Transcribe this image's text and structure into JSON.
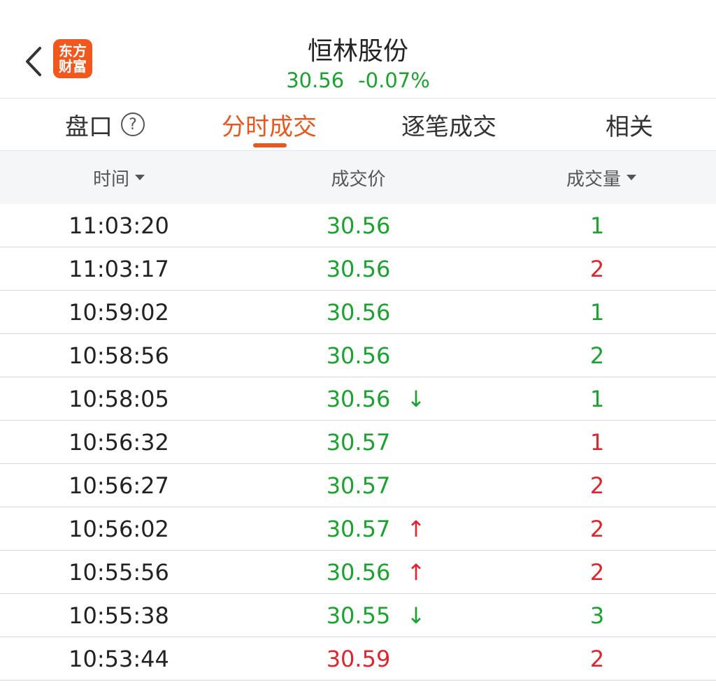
{
  "header": {
    "logo_line1": "东方",
    "logo_line2": "财富",
    "title": "恒林股份",
    "price": "30.56",
    "change": "-0.07%"
  },
  "tabs": [
    {
      "label": "盘口",
      "help": "?"
    },
    {
      "label": "分时成交"
    },
    {
      "label": "逐笔成交"
    },
    {
      "label": "相关"
    }
  ],
  "columns": {
    "time": "时间",
    "price": "成交价",
    "volume": "成交量"
  },
  "colors": {
    "green": "#1aa32e",
    "red": "#e0252f",
    "accent": "#e8581e"
  },
  "trades": [
    {
      "time": "11:03:20",
      "price": "30.56",
      "price_color": "green",
      "arrow": "",
      "arrow_color": "",
      "volume": "1",
      "volume_color": "green"
    },
    {
      "time": "11:03:17",
      "price": "30.56",
      "price_color": "green",
      "arrow": "",
      "arrow_color": "",
      "volume": "2",
      "volume_color": "red"
    },
    {
      "time": "10:59:02",
      "price": "30.56",
      "price_color": "green",
      "arrow": "",
      "arrow_color": "",
      "volume": "1",
      "volume_color": "green"
    },
    {
      "time": "10:58:56",
      "price": "30.56",
      "price_color": "green",
      "arrow": "",
      "arrow_color": "",
      "volume": "2",
      "volume_color": "green"
    },
    {
      "time": "10:58:05",
      "price": "30.56",
      "price_color": "green",
      "arrow": "↓",
      "arrow_color": "green",
      "volume": "1",
      "volume_color": "green"
    },
    {
      "time": "10:56:32",
      "price": "30.57",
      "price_color": "green",
      "arrow": "",
      "arrow_color": "",
      "volume": "1",
      "volume_color": "red"
    },
    {
      "time": "10:56:27",
      "price": "30.57",
      "price_color": "green",
      "arrow": "",
      "arrow_color": "",
      "volume": "2",
      "volume_color": "red"
    },
    {
      "time": "10:56:02",
      "price": "30.57",
      "price_color": "green",
      "arrow": "↑",
      "arrow_color": "red",
      "volume": "2",
      "volume_color": "red"
    },
    {
      "time": "10:55:56",
      "price": "30.56",
      "price_color": "green",
      "arrow": "↑",
      "arrow_color": "red",
      "volume": "2",
      "volume_color": "red"
    },
    {
      "time": "10:55:38",
      "price": "30.55",
      "price_color": "green",
      "arrow": "↓",
      "arrow_color": "green",
      "volume": "3",
      "volume_color": "green"
    },
    {
      "time": "10:53:44",
      "price": "30.59",
      "price_color": "red",
      "arrow": "",
      "arrow_color": "",
      "volume": "2",
      "volume_color": "red"
    }
  ]
}
